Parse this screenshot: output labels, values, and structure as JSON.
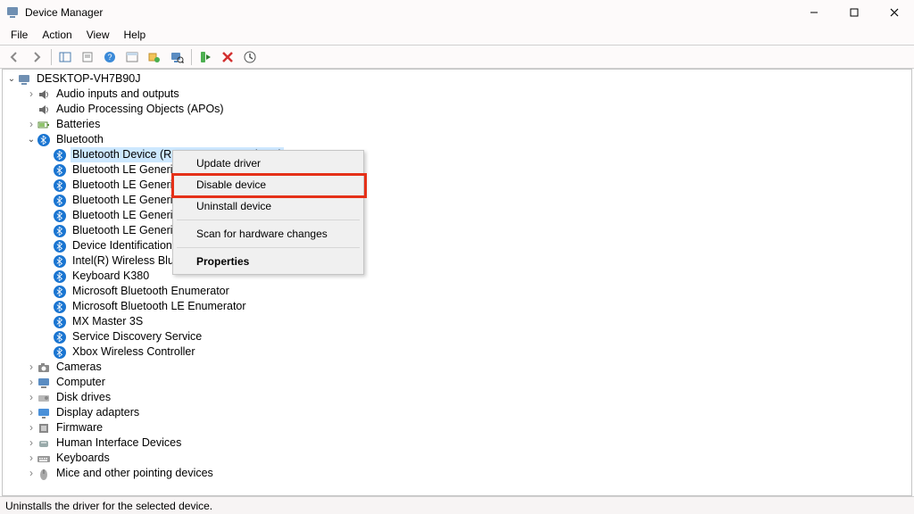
{
  "window": {
    "title": "Device Manager"
  },
  "menubar": {
    "items": [
      "File",
      "Action",
      "View",
      "Help"
    ]
  },
  "statusbar": {
    "text": "Uninstalls the driver for the selected device."
  },
  "context_menu": {
    "items": [
      {
        "label": "Update driver",
        "bold": false
      },
      {
        "label": "Disable device",
        "bold": false,
        "highlight": true
      },
      {
        "label": "Uninstall device",
        "bold": false
      },
      {
        "sep": true
      },
      {
        "label": "Scan for hardware changes",
        "bold": false
      },
      {
        "sep": true
      },
      {
        "label": "Properties",
        "bold": true
      }
    ]
  },
  "tree": {
    "root": "DESKTOP-VH7B90J",
    "nodes": [
      {
        "level": 1,
        "expand": "closed",
        "icon": "audio",
        "label": "Audio inputs and outputs"
      },
      {
        "level": 1,
        "expand": "none",
        "icon": "audio",
        "label": "Audio Processing Objects (APOs)"
      },
      {
        "level": 1,
        "expand": "closed",
        "icon": "battery",
        "label": "Batteries"
      },
      {
        "level": 1,
        "expand": "open",
        "icon": "bt",
        "label": "Bluetooth"
      },
      {
        "level": 2,
        "expand": "none",
        "icon": "bt",
        "label": "Bluetooth Device (RFCOMM Protocol TDI)",
        "selected": true
      },
      {
        "level": 2,
        "expand": "none",
        "icon": "bt",
        "label": "Bluetooth LE Generi"
      },
      {
        "level": 2,
        "expand": "none",
        "icon": "bt",
        "label": "Bluetooth LE Generi"
      },
      {
        "level": 2,
        "expand": "none",
        "icon": "bt",
        "label": "Bluetooth LE Generi"
      },
      {
        "level": 2,
        "expand": "none",
        "icon": "bt",
        "label": "Bluetooth LE Generi"
      },
      {
        "level": 2,
        "expand": "none",
        "icon": "bt",
        "label": "Bluetooth LE Generi"
      },
      {
        "level": 2,
        "expand": "none",
        "icon": "bt",
        "label": "Device Identification"
      },
      {
        "level": 2,
        "expand": "none",
        "icon": "bt",
        "label": "Intel(R) Wireless Blu"
      },
      {
        "level": 2,
        "expand": "none",
        "icon": "bt",
        "label": "Keyboard K380"
      },
      {
        "level": 2,
        "expand": "none",
        "icon": "bt",
        "label": "Microsoft Bluetooth Enumerator"
      },
      {
        "level": 2,
        "expand": "none",
        "icon": "bt",
        "label": "Microsoft Bluetooth LE Enumerator"
      },
      {
        "level": 2,
        "expand": "none",
        "icon": "bt",
        "label": "MX Master 3S"
      },
      {
        "level": 2,
        "expand": "none",
        "icon": "bt",
        "label": "Service Discovery Service"
      },
      {
        "level": 2,
        "expand": "none",
        "icon": "bt",
        "label": "Xbox Wireless Controller"
      },
      {
        "level": 1,
        "expand": "closed",
        "icon": "camera",
        "label": "Cameras"
      },
      {
        "level": 1,
        "expand": "closed",
        "icon": "computer",
        "label": "Computer"
      },
      {
        "level": 1,
        "expand": "closed",
        "icon": "disk",
        "label": "Disk drives"
      },
      {
        "level": 1,
        "expand": "closed",
        "icon": "display",
        "label": "Display adapters"
      },
      {
        "level": 1,
        "expand": "closed",
        "icon": "firmware",
        "label": "Firmware"
      },
      {
        "level": 1,
        "expand": "closed",
        "icon": "hid",
        "label": "Human Interface Devices"
      },
      {
        "level": 1,
        "expand": "closed",
        "icon": "keyboard",
        "label": "Keyboards"
      },
      {
        "level": 1,
        "expand": "closed",
        "icon": "mouse",
        "label": "Mice and other pointing devices"
      }
    ]
  }
}
